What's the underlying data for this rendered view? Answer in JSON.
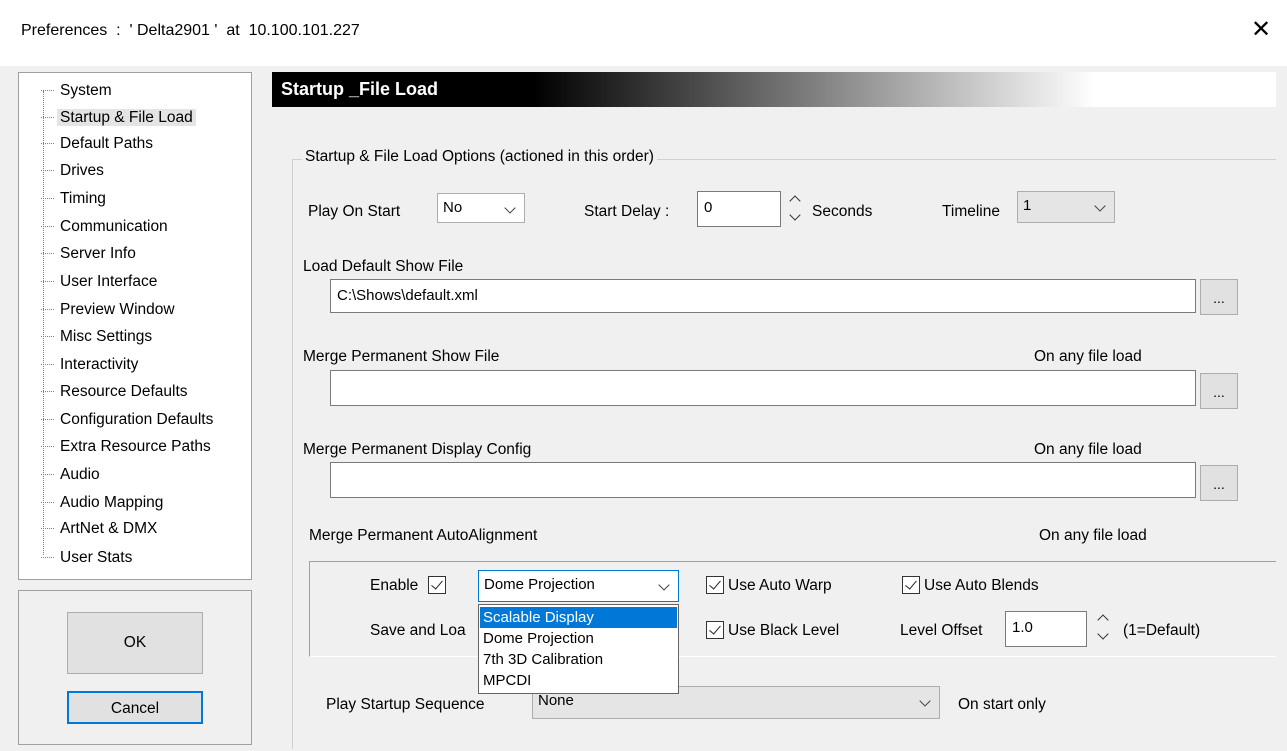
{
  "window": {
    "title": "Preferences  :  ' Delta2901 '  at  10.100.101.227"
  },
  "tree": {
    "items": [
      {
        "label": "System"
      },
      {
        "label": "Startup & File Load"
      },
      {
        "label": "Default Paths"
      },
      {
        "label": "Drives"
      },
      {
        "label": "Timing"
      },
      {
        "label": "Communication"
      },
      {
        "label": "Server Info"
      },
      {
        "label": "User Interface"
      },
      {
        "label": "Preview Window"
      },
      {
        "label": "Misc Settings"
      },
      {
        "label": "Interactivity"
      },
      {
        "label": "Resource Defaults"
      },
      {
        "label": "Configuration Defaults"
      },
      {
        "label": "Extra Resource Paths"
      },
      {
        "label": "Audio"
      },
      {
        "label": "Audio Mapping"
      },
      {
        "label": "ArtNet & DMX"
      },
      {
        "label": "User Stats"
      }
    ],
    "selected_index": 1
  },
  "buttons": {
    "ok": "OK",
    "cancel": "Cancel"
  },
  "header": {
    "title": "Startup _File Load"
  },
  "group": {
    "title": "Startup & File Load Options (actioned in this order)"
  },
  "play_on_start": {
    "label": "Play On Start",
    "value": "No"
  },
  "start_delay": {
    "label": "Start Delay :",
    "value": "0",
    "unit": "Seconds"
  },
  "timeline": {
    "label": "Timeline",
    "value": "1"
  },
  "default_show": {
    "label": "Load Default Show File",
    "value": "C:\\Shows\\default.xml",
    "browse": "..."
  },
  "merge_show": {
    "label": "Merge Permanent Show File",
    "note": "On any file load",
    "value": "",
    "browse": "..."
  },
  "merge_display": {
    "label": "Merge Permanent Display Config",
    "note": "On any file load",
    "value": "",
    "browse": "..."
  },
  "auto_alignment": {
    "label": "Merge Permanent AutoAlignment",
    "note": "On any file load",
    "enable_label": "Enable",
    "enable_checked": true,
    "mode_value": "Dome Projection",
    "use_auto_warp": "Use Auto Warp",
    "use_auto_blends": "Use Auto Blends",
    "save_and_load": "Save and Loa",
    "use_black_level": "Use Black Level",
    "level_offset_label": "Level Offset",
    "level_offset_value": "1.0",
    "level_offset_note": "(1=Default)",
    "dropdown_options": [
      "Scalable Display",
      "Dome Projection",
      "7th 3D Calibration",
      "MPCDI"
    ],
    "dropdown_highlighted": "Scalable Display"
  },
  "startup_sequence": {
    "label": "Play Startup Sequence",
    "value": "None",
    "note": "On start only"
  }
}
